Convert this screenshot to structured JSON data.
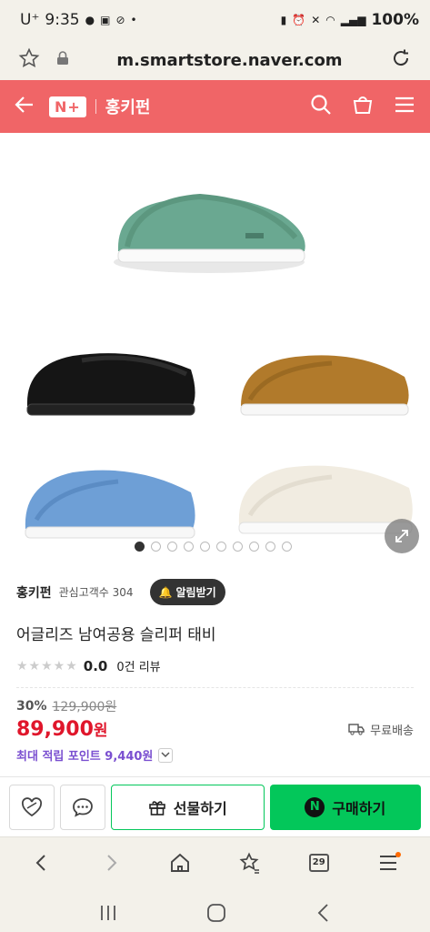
{
  "status": {
    "carrier": "U⁺",
    "time": "9:35",
    "battery": "100%"
  },
  "url_bar": {
    "url": "m.smartstore.naver.com"
  },
  "header": {
    "brand_badge": "N+",
    "store_name": "홍키펀"
  },
  "gallery": {
    "dot_count": 10,
    "active_index": 0
  },
  "product": {
    "seller_name": "홍키펀",
    "seller_meta": "관심고객수 304",
    "alarm_label": "알림받기",
    "title": "어글리즈 남여공용 슬리퍼 태비",
    "stars": "★★★★★",
    "rating": "0.0",
    "review_count": "0건 리뷰",
    "discount": "30%",
    "original_price": "129,900원",
    "price": "89,900",
    "price_unit": "원",
    "shipping": "무료배송",
    "points": "최대 적립 포인트 9,440원"
  },
  "actions": {
    "gift_label": "선물하기",
    "buy_label": "구매하기",
    "buy_badge": "N"
  },
  "browser": {
    "tab_count": "29"
  },
  "colors": {
    "brand": "#f06567",
    "buy": "#03c75a",
    "price": "#e0162b",
    "points": "#7a4fd0"
  }
}
